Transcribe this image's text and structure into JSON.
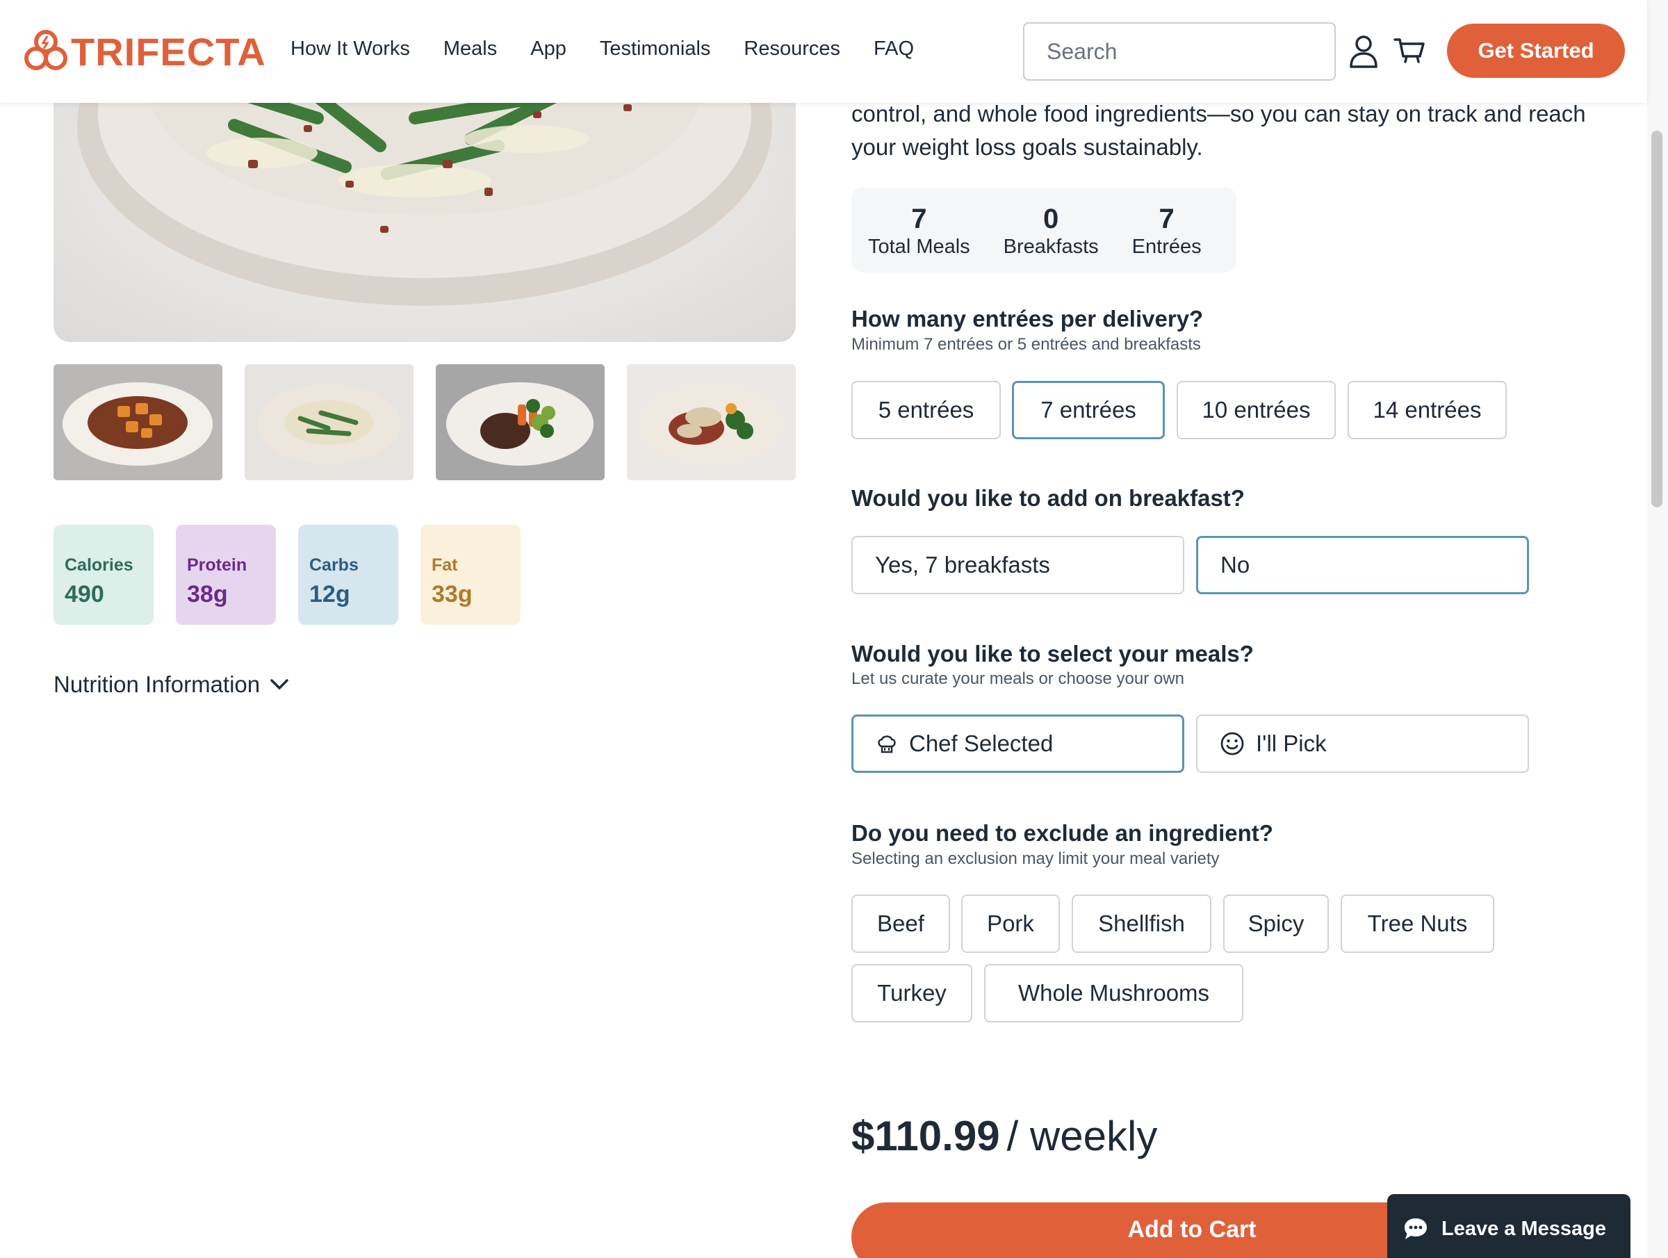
{
  "header": {
    "logo_text": "TRIFECTA",
    "nav": [
      "How It Works",
      "Meals",
      "App",
      "Testimonials",
      "Resources",
      "FAQ"
    ],
    "search_placeholder": "Search",
    "get_started_label": "Get Started"
  },
  "gallery": {
    "thumbnails": [
      "thumbnail-1",
      "thumbnail-2",
      "thumbnail-3",
      "thumbnail-4"
    ]
  },
  "macros": [
    {
      "label": "Calories",
      "value": "490",
      "bg": "#dcefe9",
      "color": "#2f6b5a"
    },
    {
      "label": "Protein",
      "value": "38g",
      "bg": "#e6d5ee",
      "color": "#6b2a8a"
    },
    {
      "label": "Carbs",
      "value": "12g",
      "bg": "#d6e6ef",
      "color": "#2b5d80"
    },
    {
      "label": "Fat",
      "value": "33g",
      "bg": "#fbf0db",
      "color": "#b07a2a"
    }
  ],
  "nutrition_toggle_label": "Nutrition Information",
  "intro_text": "control, and whole food ingredients—so you can stay on track and reach your weight loss goals sustainably.",
  "summary": [
    {
      "num": "7",
      "label": "Total Meals"
    },
    {
      "num": "0",
      "label": "Breakfasts"
    },
    {
      "num": "7",
      "label": "Entrées"
    }
  ],
  "entrees_question": {
    "title": "How many entrées per delivery?",
    "subtitle": "Minimum 7 entrées or 5 entrées and breakfasts",
    "options": [
      "5 entrées",
      "7 entrées",
      "10 entrées",
      "14 entrées"
    ],
    "selected": "7 entrées"
  },
  "breakfast_question": {
    "title": "Would you like to add on breakfast?",
    "options": [
      "Yes, 7 breakfasts",
      "No"
    ],
    "selected": "No"
  },
  "select_question": {
    "title": "Would you like to select your meals?",
    "subtitle": "Let us curate your meals or choose your own",
    "options": [
      "Chef Selected",
      "I'll Pick"
    ],
    "selected": "Chef Selected"
  },
  "exclude_question": {
    "title": "Do you need to exclude an ingredient?",
    "subtitle": "Selecting an exclusion may limit your meal variety",
    "options": [
      "Beef",
      "Pork",
      "Shellfish",
      "Spicy",
      "Tree Nuts",
      "Turkey",
      "Whole Mushrooms"
    ]
  },
  "price": {
    "amount": "$110.99",
    "period": "/ weekly"
  },
  "add_to_cart_label": "Add to Cart",
  "chat_label": "Leave a Message",
  "colors": {
    "brand": "#e0603a",
    "selected_border": "#5b93b5",
    "text": "#1f2a37"
  }
}
